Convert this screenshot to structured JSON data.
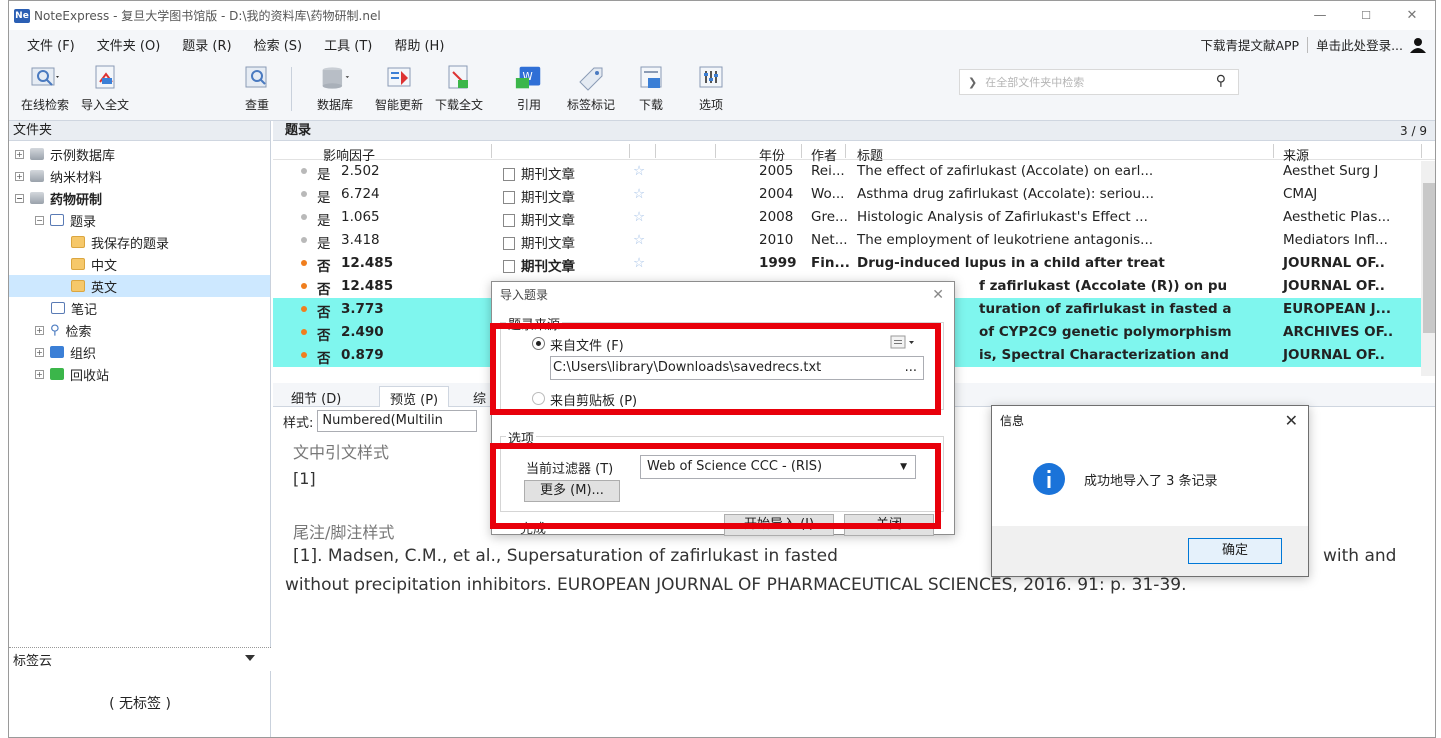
{
  "window": {
    "title": "NoteExpress - 复旦大学图书馆版 - D:\\我的资料库\\药物研制.nel",
    "app_icon": "Ne",
    "controls": {
      "minimize": "—",
      "maximize": "☐",
      "close": "✕"
    }
  },
  "menu": {
    "items": [
      "文件 (F)",
      "文件夹 (O)",
      "题录 (R)",
      "检索 (S)",
      "工具 (T)",
      "帮助 (H)"
    ],
    "right": {
      "app_link": "下载青提文献APP",
      "login": "单击此处登录..."
    }
  },
  "toolbar": {
    "buttons": [
      "在线检索",
      "导入全文",
      "查重",
      "数据库",
      "智能更新",
      "下载全文",
      "引用",
      "标签标记",
      "下载",
      "选项"
    ],
    "search_placeholder": "在全部文件夹中检索"
  },
  "left_panel": {
    "header": "文件夹",
    "tree": [
      {
        "label": "示例数据库"
      },
      {
        "label": "纳米材料"
      },
      {
        "label": "药物研制"
      },
      {
        "label": "题录"
      },
      {
        "label": "我保存的题录"
      },
      {
        "label": "中文"
      },
      {
        "label": "英文"
      },
      {
        "label": "笔记"
      },
      {
        "label": "检索"
      },
      {
        "label": "组织"
      },
      {
        "label": "回收站"
      }
    ],
    "tag_cloud": {
      "header": "标签云",
      "empty": "( 无标签 )"
    }
  },
  "list": {
    "header": "题录",
    "count": "3 / 9",
    "columns": {
      "impact": "影响因子",
      "year": "年份",
      "author": "作者",
      "title": "标题",
      "source": "来源"
    },
    "rows": [
      {
        "read": "是",
        "impact": "2.502",
        "type": "期刊文章",
        "year": "2005",
        "author": "Rei...",
        "title": "The effect of zafirlukast (Accolate) on earl...",
        "source": "Aesthet Surg J"
      },
      {
        "read": "是",
        "impact": "6.724",
        "type": "期刊文章",
        "year": "2004",
        "author": "Wo...",
        "title": "Asthma drug zafirlukast (Accolate): seriou...",
        "source": "CMAJ"
      },
      {
        "read": "是",
        "impact": "1.065",
        "type": "期刊文章",
        "year": "2008",
        "author": "Gre...",
        "title": "Histologic Analysis of Zafirlukast's Effect ...",
        "source": "Aesthetic Plas..."
      },
      {
        "read": "是",
        "impact": "3.418",
        "type": "期刊文章",
        "year": "2010",
        "author": "Net...",
        "title": "The employment of leukotriene antagonis...",
        "source": "Mediators Infl..."
      },
      {
        "read": "否",
        "impact": "12.485",
        "type": "期刊文章",
        "year": "1999",
        "author": "Fin...",
        "title": "Drug-induced lupus in a child after treat",
        "source": "JOURNAL OF.."
      },
      {
        "read": "否",
        "impact": "12.485",
        "title": "f zafirlukast (Accolate (R)) on pu",
        "source": "JOURNAL OF.."
      },
      {
        "read": "否",
        "impact": "3.773",
        "title": "turation of zafirlukast in fasted a",
        "source": "EUROPEAN J..."
      },
      {
        "read": "否",
        "impact": "2.490",
        "title": "of CYP2C9 genetic polymorphism",
        "source": "ARCHIVES OF.."
      },
      {
        "read": "否",
        "impact": "0.879",
        "title": "is, Spectral Characterization and",
        "source": "JOURNAL OF.."
      }
    ]
  },
  "tabs": {
    "detail": "细节 (D)",
    "preview": "预览 (P)",
    "third": "综"
  },
  "style": {
    "label": "样式:",
    "value": "Numbered(Multilin"
  },
  "preview": {
    "in_text_heading": "文中引文样式",
    "in_text_value": "[1]",
    "footnote_heading": "尾注/脚注样式",
    "footnote_line1_left": "[1].    Madsen, C.M., et al., Supersaturation of zafirlukast in fasted",
    "footnote_line1_right": "with and",
    "footnote_line2": "without precipitation inhibitors. EUROPEAN JOURNAL OF PHARMACEUTICAL SCIENCES, 2016. 91: p. 31-39."
  },
  "import_dialog": {
    "title": "导入题录",
    "source_group": "题录来源",
    "from_file": "来自文件 (F)",
    "file_path": "C:\\Users\\library\\Downloads\\savedrecs.txt",
    "browse": "...",
    "from_clipboard": "来自剪贴板 (P)",
    "options_group": "选项",
    "filter_label": "当前过滤器 (T)",
    "filter_value": "Web of Science CCC - (RIS)",
    "more": "更多 (M)...",
    "start": "开始导入 (I)",
    "close": "关闭",
    "done": "完成"
  },
  "info_dialog": {
    "title": "信息",
    "message": "成功地导入了 3 条记录",
    "ok": "确定"
  },
  "colors": {
    "highlight": "#7ff6ee",
    "accent_red": "#e8000b",
    "orange_dot": "#f07e1e",
    "info_blue": "#1a73d9"
  }
}
